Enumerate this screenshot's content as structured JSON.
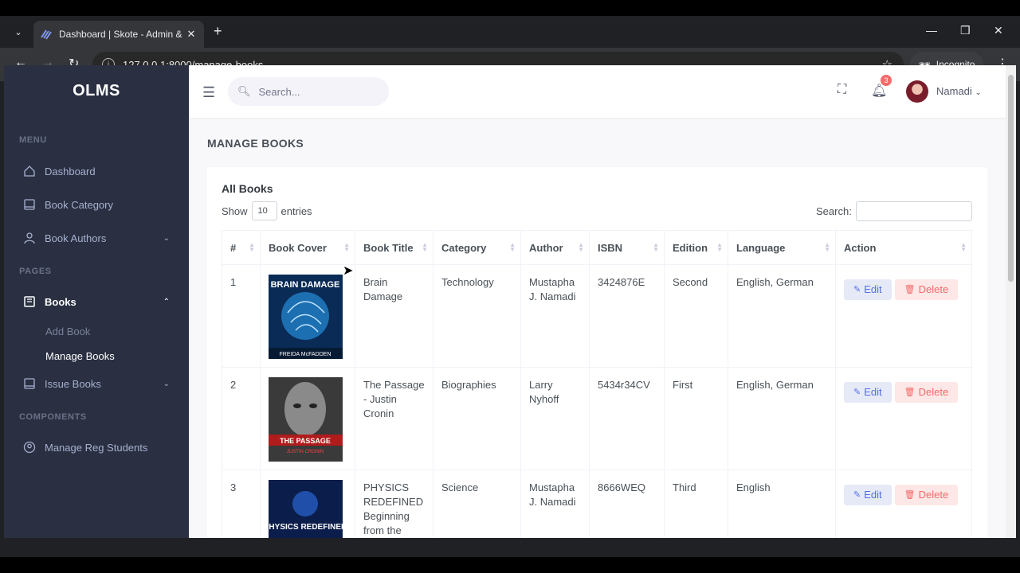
{
  "browser": {
    "tab_title": "Dashboard | Skote - Admin & D",
    "url": "127.0.0.1:8000/manage-books",
    "incognito_label": "Incognito"
  },
  "sidebar": {
    "logo": "OLMS",
    "section_menu": "MENU",
    "section_pages": "PAGES",
    "section_components": "COMPONENTS",
    "items": {
      "dashboard": "Dashboard",
      "book_category": "Book Category",
      "book_authors": "Book Authors",
      "books": "Books",
      "add_book": "Add Book",
      "manage_books": "Manage Books",
      "issue_books": "Issue Books",
      "manage_reg_students": "Manage Reg Students"
    }
  },
  "topbar": {
    "search_placeholder": "Search...",
    "notification_count": "3",
    "user_name": "Namadi"
  },
  "page": {
    "title": "MANAGE BOOKS",
    "card_title": "All Books",
    "show_label": "Show",
    "entries_value": "10",
    "entries_label": "entries",
    "search_label": "Search:"
  },
  "table": {
    "headers": [
      "#",
      "Book Cover",
      "Book Title",
      "Category",
      "Author",
      "ISBN",
      "Edition",
      "Language",
      "Action"
    ],
    "rows": [
      {
        "num": "1",
        "cover_text": "BRAIN DAMAGE",
        "cover_author": "FREIDA McFADDEN",
        "title": "Brain Damage",
        "category": "Technology",
        "author": "Mustapha J. Namadi",
        "isbn": "3424876E",
        "edition": "Second",
        "language": "English, German"
      },
      {
        "num": "2",
        "cover_text": "THE PASSAGE",
        "cover_author": "JUSTIN CRONIN",
        "title": "The Passage - Justin Cronin",
        "category": "Biographies",
        "author": "Larry Nyhoff",
        "isbn": "5434r34CV",
        "edition": "First",
        "language": "English, German"
      },
      {
        "num": "3",
        "cover_text": "PHYSICS REDEFINED",
        "cover_author": "",
        "title": "PHYSICS REDEFINED Beginning from the",
        "category": "Science",
        "author": "Mustapha J. Namadi",
        "isbn": "8666WEQ",
        "edition": "Third",
        "language": "English"
      }
    ],
    "edit_label": "Edit",
    "delete_label": "Delete"
  }
}
